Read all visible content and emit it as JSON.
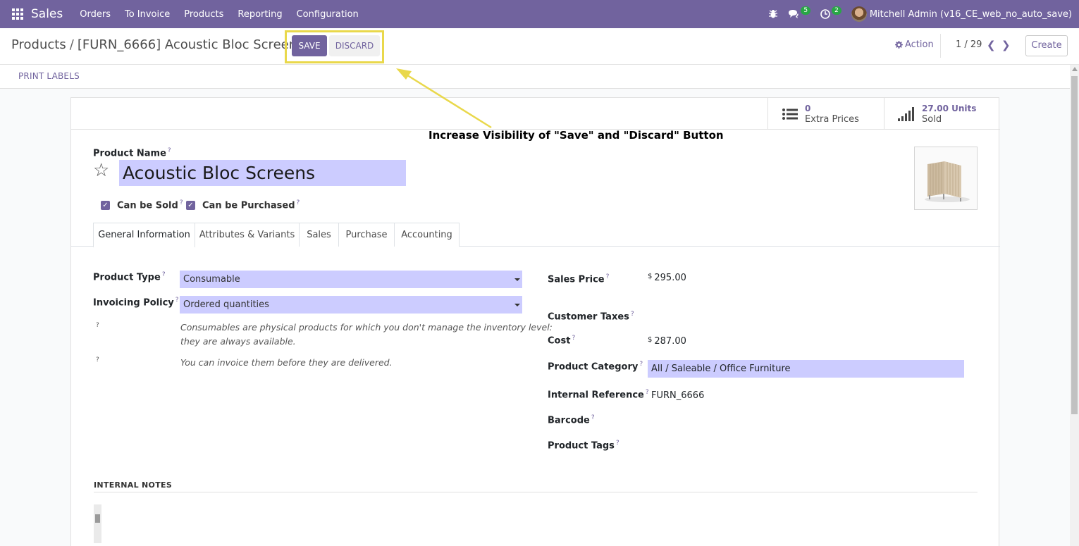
{
  "navbar": {
    "app_name": "Sales",
    "menu": [
      "Orders",
      "To Invoice",
      "Products",
      "Reporting",
      "Configuration"
    ],
    "messages_count": "5",
    "activities_count": "2",
    "user_name": "Mitchell Admin (v16_CE_web_no_auto_save)"
  },
  "control_panel": {
    "breadcrumb_parent": "Products",
    "breadcrumb_separator": "/",
    "breadcrumb_current": "[FURN_6666] Acoustic Bloc Screens",
    "save_label": "SAVE",
    "discard_label": "DISCARD",
    "action_label": "Action",
    "pager": "1 / 29",
    "create_label": "Create"
  },
  "statusbar": {
    "print_labels": "PRINT LABELS"
  },
  "stat_buttons": {
    "extra_prices_value": "0",
    "extra_prices_label": "Extra Prices",
    "sold_value": "27.00 Units",
    "sold_label": "Sold"
  },
  "annotation": {
    "text": "Increase Visibility of \"Save\" and \"Discard\" Button",
    "color": "#e9d84b"
  },
  "product": {
    "name_label": "Product Name",
    "name": "Acoustic Bloc Screens",
    "can_be_sold_label": "Can be Sold",
    "can_be_sold": true,
    "can_be_purchased_label": "Can be Purchased",
    "can_be_purchased": true
  },
  "tabs": [
    "General Information",
    "Attributes & Variants",
    "Sales",
    "Purchase",
    "Accounting"
  ],
  "general": {
    "product_type_label": "Product Type",
    "product_type": "Consumable",
    "invoicing_policy_label": "Invoicing Policy",
    "invoicing_policy": "Ordered quantities",
    "help_q": "?",
    "help_1_line1": "Consumables are physical products for which you don't manage the inventory level:",
    "help_1_line2": "they are always available.",
    "help_2": "You can invoice them before they are delivered.",
    "sales_price_label": "Sales Price",
    "currency": "$",
    "sales_price": "295.00",
    "customer_taxes_label": "Customer Taxes",
    "cost_label": "Cost",
    "cost": "287.00",
    "product_category_label": "Product Category",
    "product_category": "All / Saleable / Office Furniture",
    "internal_reference_label": "Internal Reference",
    "internal_reference": "FURN_6666",
    "barcode_label": "Barcode",
    "product_tags_label": "Product Tags"
  },
  "notes": {
    "title": "INTERNAL NOTES"
  },
  "colors": {
    "brand": "#71639e",
    "input_highlight": "#ccccff",
    "badge": "#28a745"
  }
}
